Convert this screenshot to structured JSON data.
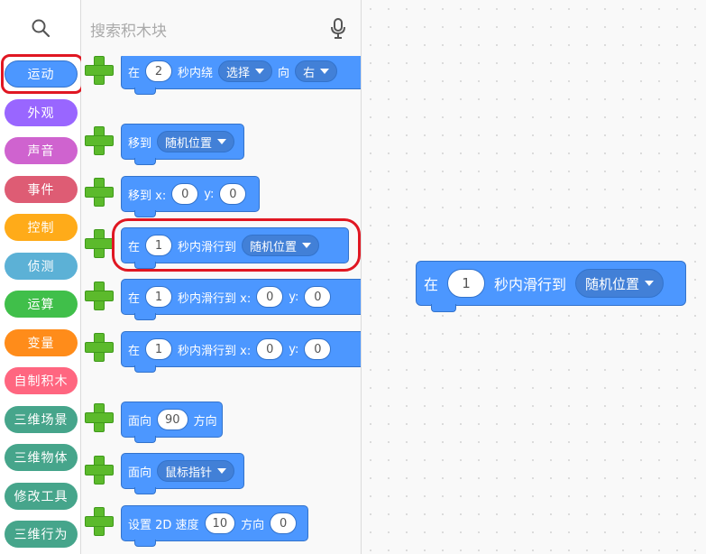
{
  "palette": {
    "search_placeholder": "搜索积木块"
  },
  "categories": [
    {
      "label": "运动",
      "color": "#4c97ff"
    },
    {
      "label": "外观",
      "color": "#9966ff"
    },
    {
      "label": "声音",
      "color": "#cf63cf"
    },
    {
      "label": "事件",
      "color": "#de5c74"
    },
    {
      "label": "控制",
      "color": "#ffab19"
    },
    {
      "label": "侦测",
      "color": "#5cb1d6"
    },
    {
      "label": "运算",
      "color": "#40bf4a"
    },
    {
      "label": "变量",
      "color": "#ff8c1a"
    },
    {
      "label": "自制积木",
      "color": "#ff6680"
    },
    {
      "label": "三维场景",
      "color": "#46a58b"
    },
    {
      "label": "三维物体",
      "color": "#46a58b"
    },
    {
      "label": "修改工具",
      "color": "#46a58b"
    },
    {
      "label": "三维行为",
      "color": "#46a58b"
    }
  ],
  "blocks": {
    "turn": {
      "t1": "在",
      "v1": "2",
      "t2": "秒内绕",
      "m1": "选择",
      "t3": "向",
      "m2": "右"
    },
    "goto": {
      "t1": "移到",
      "m1": "随机位置"
    },
    "goto_xy": {
      "t1": "移到 x:",
      "v1": "0",
      "t2": "y:",
      "v2": "0"
    },
    "glide": {
      "t1": "在",
      "v1": "1",
      "t2": "秒内滑行到",
      "m1": "随机位置"
    },
    "glide_xy_1": {
      "t1": "在",
      "v1": "1",
      "t2": "秒内滑行到 x:",
      "v2": "0",
      "t3": "y:",
      "v3": "0"
    },
    "glide_xy_2": {
      "t1": "在",
      "v1": "1",
      "t2": "秒内滑行到 x:",
      "v2": "0",
      "t3": "y:",
      "v3": "0"
    },
    "point": {
      "t1": "面向",
      "v1": "90",
      "t2": "方向"
    },
    "point_towards": {
      "t1": "面向",
      "m1": "鼠标指针"
    },
    "speed": {
      "t1": "设置 2D 速度",
      "v1": "10",
      "t2": "方向",
      "v2": "0"
    }
  },
  "workspace": {
    "glide": {
      "t1": "在",
      "v1": "1",
      "t2": "秒内滑行到",
      "m1": "随机位置"
    }
  }
}
